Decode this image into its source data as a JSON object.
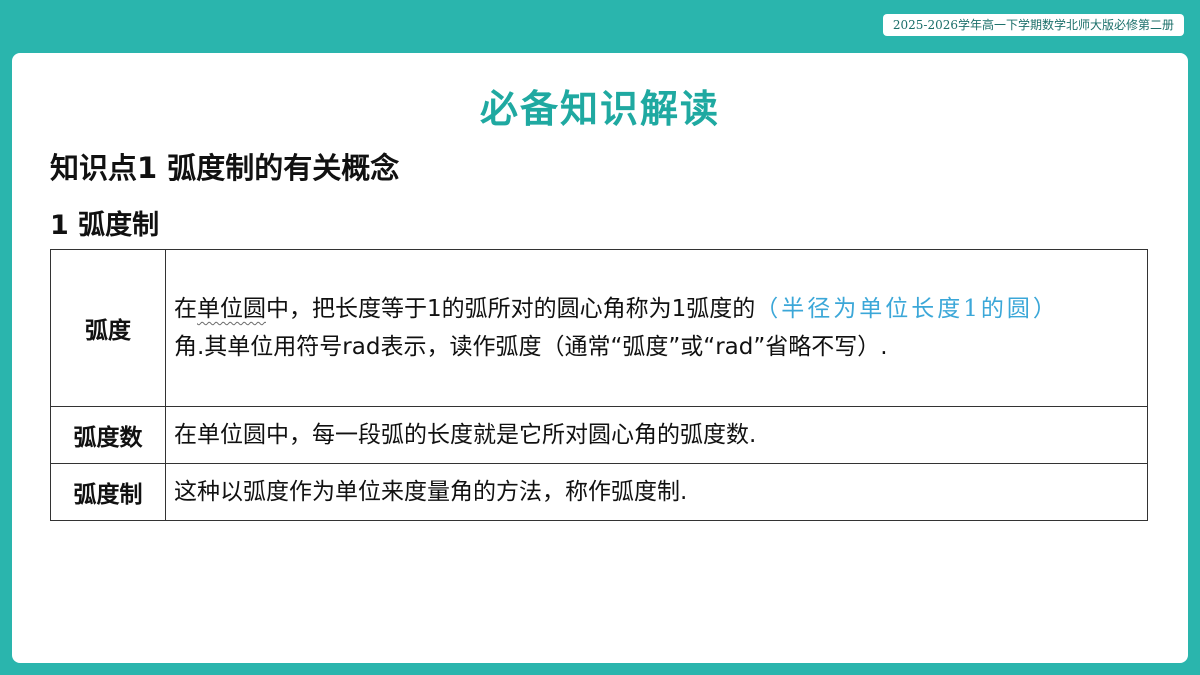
{
  "header": {
    "badge": "2025-2026学年高一下学期数学北师大版必修第二册"
  },
  "page": {
    "title": "必备知识解读",
    "section_title": "知识点1  弧度制的有关概念",
    "sub_title": "1  弧度制"
  },
  "table": {
    "rows": [
      {
        "term": "弧度",
        "desc_before": "在",
        "desc_underlined": "单位圆",
        "desc_after": "中，把长度等于1的弧所对的圆心角称为1弧度的",
        "note": "（半径为单位长度1的圆）",
        "desc_line2": "角.其单位用符号rad表示，读作弧度（通常“弧度”或“rad”省略不写）."
      },
      {
        "term": "弧度数",
        "desc": "在单位圆中，每一段弧的长度就是它所对圆心角的弧度数."
      },
      {
        "term": "弧度制",
        "desc": "这种以弧度作为单位来度量角的方法，称作弧度制."
      }
    ]
  },
  "colors": {
    "accent": "#2ab5ad",
    "title": "#1fa9a1",
    "note": "#3ba7d8"
  }
}
